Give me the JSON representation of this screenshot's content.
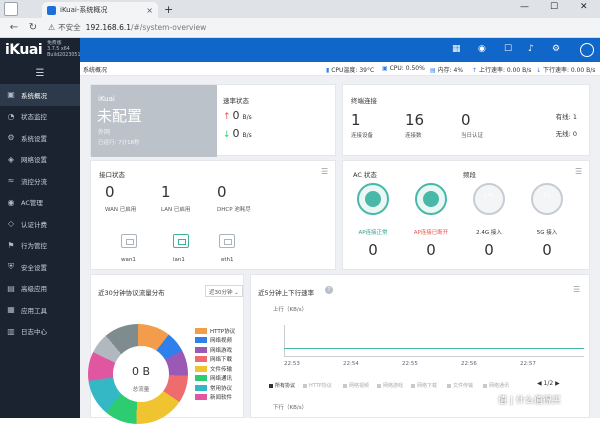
{
  "browser": {
    "tab_title": "iKuai-系统概况",
    "security": "不安全",
    "url_host": "192.168.6.1",
    "url_path": "/#/system-overview"
  },
  "brand": {
    "logo": "iKuai",
    "edition": "免费版",
    "version": "3.7.5 x64 Build202305101110"
  },
  "sidebar": {
    "items": [
      "系统概况",
      "状态监控",
      "系统设置",
      "网络设置",
      "流控分流",
      "AC管理",
      "认证计费",
      "行为管控",
      "安全设置",
      "高级应用",
      "应用工具",
      "日志中心"
    ]
  },
  "status": {
    "breadcrumb": "系统概况",
    "cpu_temp_label": "CPU温度: ",
    "cpu_temp": "39°C",
    "cpu_label": "CPU: ",
    "cpu": "0.50%",
    "mem_label": "内存: ",
    "mem": "4%",
    "up_label": "上行速率: ",
    "up": "0.00 B/s",
    "down_label": "下行速率: ",
    "down": "0.00 B/s"
  },
  "system": {
    "name": "iKuai",
    "config_status": "未配置",
    "net": "外网",
    "uptime": "已运行: 7分18秒"
  },
  "speed": {
    "title": "速率状态",
    "up_value": "0",
    "down_value": "0",
    "unit": "B/s"
  },
  "connections": {
    "title": "终端连接",
    "items": [
      {
        "value": "1",
        "label": "连接设备"
      },
      {
        "value": "16",
        "label": "连接数"
      },
      {
        "value": "0",
        "label": "当日认证"
      }
    ],
    "wired": "有线: 1",
    "wireless": "无线: 0"
  },
  "interfaces": {
    "title": "接口状态",
    "items": [
      {
        "value": "0",
        "label": "WAN 已启用"
      },
      {
        "value": "1",
        "label": "LAN 已启用"
      },
      {
        "value": "0",
        "label": "DHCP 池耗尽"
      }
    ],
    "ports": [
      "wan1",
      "lan1",
      "eth1"
    ]
  },
  "ac": {
    "title": "AC 状态",
    "band_title": "频段",
    "items": [
      {
        "label": "AP连接正常",
        "value": "0"
      },
      {
        "label": "AP连接已断开",
        "value": "0"
      },
      {
        "label": "2.4G 接入",
        "value": "0",
        "ring": "2.4G"
      },
      {
        "label": "5G 接入",
        "value": "0",
        "ring": "5G"
      }
    ]
  },
  "protocol": {
    "title": "近30分钟协议流量分布",
    "select": "近30分钟",
    "total": "0 B",
    "total_label": "总流量",
    "legend": [
      "HTTP协议",
      "网络视频",
      "网络游戏",
      "网络下载",
      "文件传输",
      "网络通讯",
      "常用协议",
      "新闻软件"
    ]
  },
  "rate": {
    "title": "近5分钟上下行速率",
    "upload_axis": "上行（KB/s）",
    "download_axis": "下行（KB/s）",
    "ticks": [
      "22:53",
      "22:54",
      "22:55",
      "22:56",
      "22:57"
    ],
    "series": [
      "所有协议",
      "HTTP协议",
      "网络视频",
      "网络游戏",
      "网络下载",
      "文件传输",
      "网络通讯"
    ],
    "page": "1/2"
  },
  "colors": {
    "brand": "#1166c9",
    "sidebar": "#1a232f",
    "accent": "#4ab8a8",
    "legend": [
      "#f39c4b",
      "#2f80ed",
      "#9b59b6",
      "#ee6b6e",
      "#f0c330",
      "#2ecc71",
      "#34b8c6",
      "#e056a0"
    ]
  },
  "watermark": "值 | 什么值得买"
}
